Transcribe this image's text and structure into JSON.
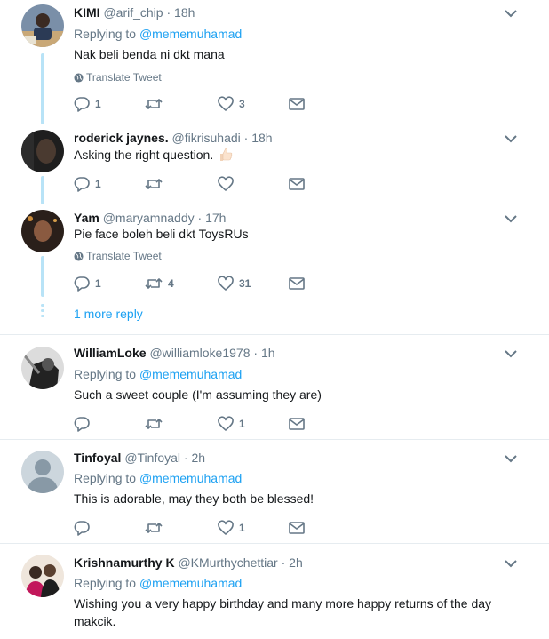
{
  "tweets": [
    {
      "name": "KIMI",
      "handle": "@arif_chip",
      "time": "18h",
      "replying_label": "Replying to",
      "replying_to": "@mememuhamad",
      "text": "Nak beli benda ni dkt mana",
      "translate": "Translate Tweet",
      "replies": "1",
      "retweets": "",
      "likes": "3"
    },
    {
      "name": "roderick jaynes.",
      "handle": "@fikrisuhadi",
      "time": "18h",
      "text": "Asking the right question.",
      "emoji": "thumbs-up-emoji",
      "replies": "1",
      "retweets": "",
      "likes": ""
    },
    {
      "name": "Yam",
      "handle": "@maryamnaddy",
      "time": "17h",
      "text": "Pie face boleh beli dkt ToysRUs",
      "translate": "Translate Tweet",
      "replies": "1",
      "retweets": "4",
      "likes": "31"
    },
    {
      "name": "WilliamLoke",
      "handle": "@williamloke1978",
      "time": "1h",
      "replying_label": "Replying to",
      "replying_to": "@mememuhamad",
      "text": "Such a sweet couple (I'm assuming they are)",
      "replies": "",
      "retweets": "",
      "likes": "1"
    },
    {
      "name": "Tinfoyal",
      "handle": "@Tinfoyal",
      "time": "2h",
      "replying_label": "Replying to",
      "replying_to": "@mememuhamad",
      "text": "This is adorable, may they both be blessed!",
      "replies": "",
      "retweets": "",
      "likes": "1"
    },
    {
      "name": "Krishnamurthy K",
      "handle": "@KMurthychettiar",
      "time": "2h",
      "replying_label": "Replying to",
      "replying_to": "@mememuhamad",
      "text_line1": "Wishing you a very happy birthday and many more happy returns of the day",
      "text_line2": "makcik."
    }
  ],
  "more_reply": "1 more reply",
  "separator": "·",
  "colors": {
    "accent": "#1da1f2",
    "muted": "#657786",
    "thread": "#b8e3f7",
    "divider": "#e6ecf0"
  },
  "icons": [
    "reply-icon",
    "retweet-icon",
    "like-icon",
    "message-icon",
    "chevron-down-icon",
    "globe-icon"
  ]
}
